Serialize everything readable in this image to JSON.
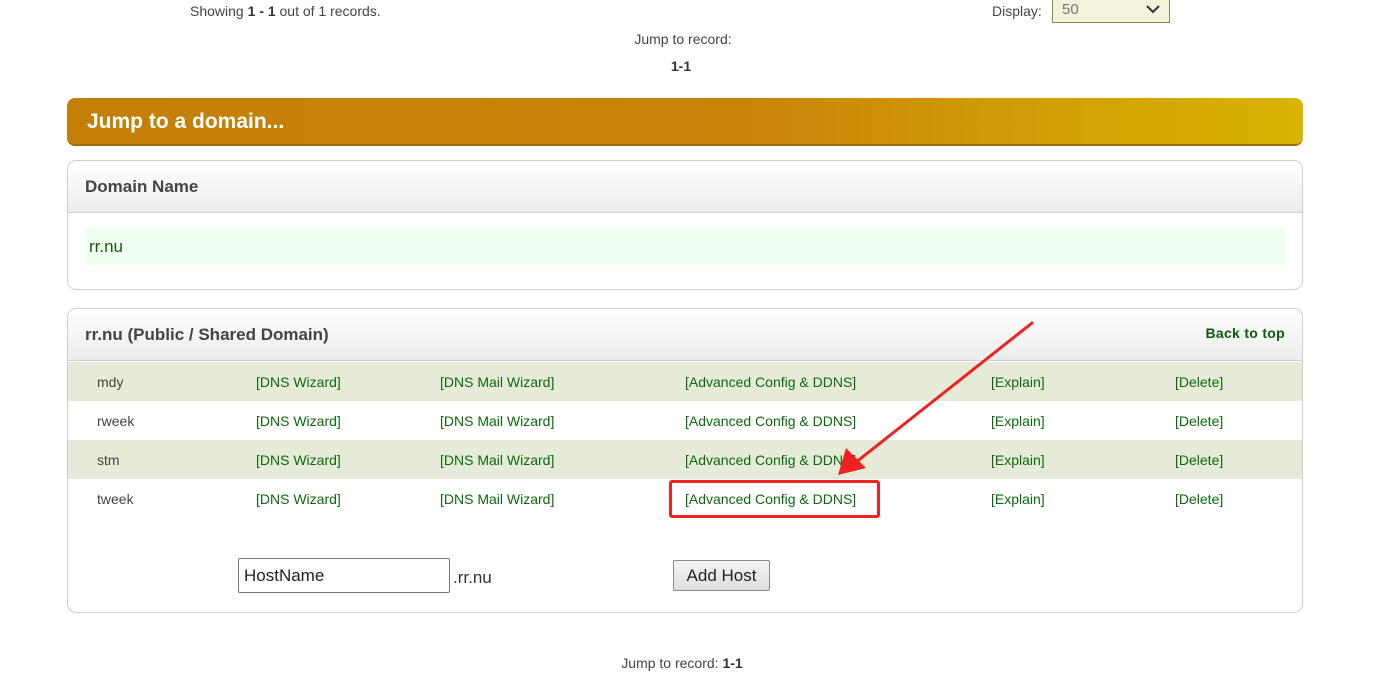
{
  "top": {
    "showing_prefix": "Showing ",
    "showing_range": "1 - 1",
    "showing_suffix": " out of 1 records.",
    "display_label": "Display:",
    "display_value": "50",
    "jump_label": "Jump to record:",
    "jump_range": "1-1"
  },
  "jump_header": "Jump to a domain...",
  "domain_panel": {
    "heading": "Domain Name",
    "domain": "rr.nu"
  },
  "hosts_panel": {
    "heading": "rr.nu (Public / Shared Domain)",
    "back_to_top": "Back to top",
    "rows": [
      {
        "name": "mdy",
        "dns_wizard": "[DNS Wizard]",
        "mail_wizard": "[DNS Mail Wizard]",
        "advanced": "[Advanced Config & DDNS]",
        "explain": "[Explain]",
        "delete": "[Delete]"
      },
      {
        "name": "rweek",
        "dns_wizard": "[DNS Wizard]",
        "mail_wizard": "[DNS Mail Wizard]",
        "advanced": "[Advanced Config & DDNS]",
        "explain": "[Explain]",
        "delete": "[Delete]"
      },
      {
        "name": "stm",
        "dns_wizard": "[DNS Wizard]",
        "mail_wizard": "[DNS Mail Wizard]",
        "advanced": "[Advanced Config & DDNS]",
        "explain": "[Explain]",
        "delete": "[Delete]"
      },
      {
        "name": "tweek",
        "dns_wizard": "[DNS Wizard]",
        "mail_wizard": "[DNS Mail Wizard]",
        "advanced": "[Advanced Config & DDNS]",
        "explain": "[Explain]",
        "delete": "[Delete]"
      }
    ],
    "hostname_value": "HostName",
    "domain_suffix": ".rr.nu",
    "add_host_label": "Add Host"
  },
  "bottom": {
    "jump_label": "Jump to record: ",
    "jump_range": "1-1"
  },
  "colors": {
    "header_orange": "#c37f06",
    "header_gold": "#d9b402",
    "link_green": "#0b6a0b",
    "row_shade": "#e6ebd9",
    "annotation_red": "#ee2222"
  },
  "icons": {
    "select_chevron": "chevron-down-icon",
    "annotation": "arrow-icon"
  }
}
